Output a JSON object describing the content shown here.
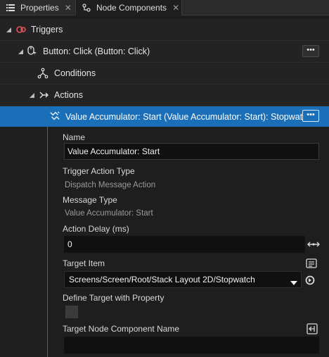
{
  "tabs": [
    {
      "label": "Properties",
      "icon": "list-icon"
    },
    {
      "label": "Node Components",
      "icon": "node-components-icon"
    }
  ],
  "tree": {
    "triggers": {
      "label": "Triggers"
    },
    "button_click": {
      "label": "Button: Click (Button: Click)",
      "more_label": "•••"
    },
    "conditions": {
      "label": "Conditions"
    },
    "actions": {
      "label": "Actions"
    },
    "value_accumulator": {
      "label": "Value Accumulator: Start (Value Accumulator: Start): Stopwatch",
      "more_label": "•••"
    }
  },
  "properties": {
    "name": {
      "label": "Name",
      "value": "Value Accumulator: Start"
    },
    "trigger_action_type": {
      "label": "Trigger Action Type",
      "value": "Dispatch Message Action"
    },
    "message_type": {
      "label": "Message Type",
      "value": "Value Accumulator: Start"
    },
    "action_delay": {
      "label": "Action Delay (ms)",
      "value": "0"
    },
    "target_item": {
      "label": "Target Item",
      "value": "Screens/Screen/Root/Stack Layout 2D/Stopwatch"
    },
    "define_target": {
      "label": "Define Target with Property",
      "checked": false
    },
    "target_node_component": {
      "label": "Target Node Component Name",
      "value": ""
    }
  },
  "colors": {
    "selection": "#1a6fb8",
    "background": "#1e1e1e",
    "trigger_icon": "#e0555a"
  }
}
